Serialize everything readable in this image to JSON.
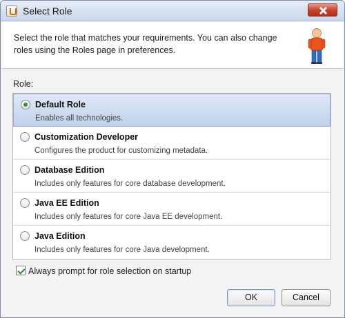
{
  "window": {
    "title": "Select Role"
  },
  "header": {
    "description": "Select the role that matches your requirements. You can also change roles using the Roles page in preferences."
  },
  "role_section": {
    "label": "Role:"
  },
  "roles": [
    {
      "title": "Default Role",
      "description": "Enables all technologies.",
      "selected": true
    },
    {
      "title": "Customization Developer",
      "description": "Configures the product for customizing metadata.",
      "selected": false
    },
    {
      "title": "Database Edition",
      "description": "Includes only features for core database development.",
      "selected": false
    },
    {
      "title": "Java EE Edition",
      "description": "Includes only features for core Java EE development.",
      "selected": false
    },
    {
      "title": "Java Edition",
      "description": "Includes only features for core Java development.",
      "selected": false
    }
  ],
  "startup_prompt": {
    "label": "Always prompt for role selection on startup",
    "checked": true
  },
  "buttons": {
    "ok": "OK",
    "cancel": "Cancel"
  },
  "colors": {
    "selection": "#c9d9ee",
    "radio_selected": "#2a9a2a",
    "close_button": "#c7452d"
  },
  "icons": {
    "title": "java-app-icon",
    "header": "person-icon",
    "close": "close-icon"
  }
}
